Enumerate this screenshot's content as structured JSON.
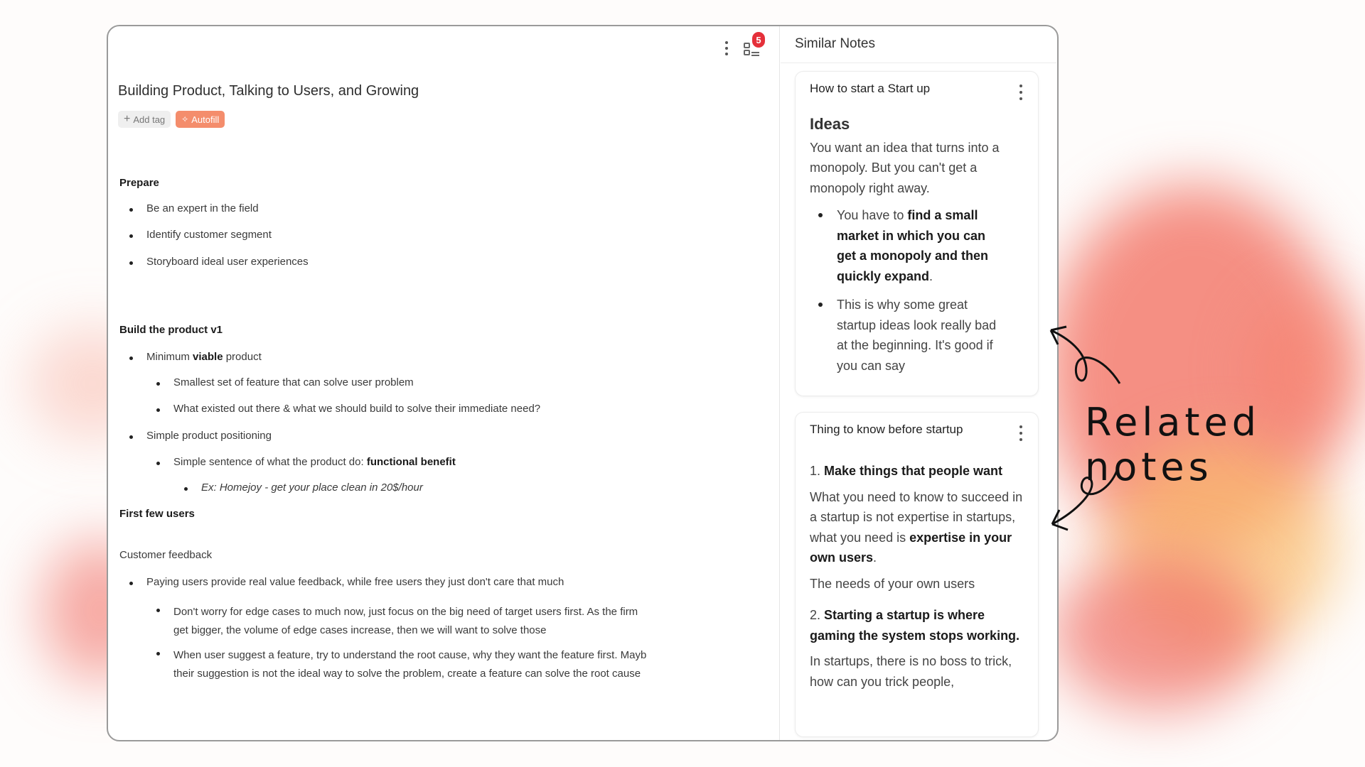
{
  "editor": {
    "toolbar": {
      "more_icon": "vertical-dots-icon",
      "list_icon": "checklist-icon",
      "badge_count": "5"
    },
    "title": "Building Product, Talking to Users, and Growing",
    "tags": {
      "add_tag": "Add tag",
      "autofill": "Autofill"
    },
    "sections": {
      "prepare": {
        "heading": "Prepare",
        "items": [
          "Be an expert in the field",
          "Identify customer segment",
          "Storyboard ideal user experiences"
        ]
      },
      "build": {
        "heading": "Build the product v1",
        "mvp_pre": "Minimum ",
        "mvp_bold": "viable",
        "mvp_post": " product",
        "mvp_sub": [
          "Smallest set of feature that can solve user problem",
          "What existed out there & what we should build to solve their immediate need?"
        ],
        "positioning": "Simple product positioning",
        "positioning_sub_pre": "Simple sentence of what the product do: ",
        "positioning_sub_bold": "functional benefit",
        "example": "Ex: Homejoy - get your place clean in 20$/hour"
      },
      "users": {
        "heading": "First few users",
        "subheading": "Customer feedback",
        "item": "Paying users provide real value feedback, while free users they just don't care that much",
        "sub1_line1": "Don't worry for edge cases to much now, just focus on the big need of target users first. As the firm",
        "sub1_line2": "get bigger, the volume of edge cases increase, then we will want to solve those",
        "sub2_line1": "When user suggest a feature, try to understand the root cause, why they want the feature first. Mayb",
        "sub2_line2": "their suggestion is not the ideal way to solve the problem, create a feature can solve the root cause"
      }
    }
  },
  "similar_notes": {
    "title": "Similar Notes",
    "cards": [
      {
        "title": "How to start a Start up",
        "heading": "Ideas",
        "para": "You want an idea that turns into a monopoly. But you can't get a monopoly right away.",
        "b1_pre": "You have to ",
        "b1_bold": "find a small market in which you can get a monopoly and then quickly expand",
        "b1_post": ".",
        "b2": "This is why some great startup ideas look really bad at the beginning. It's good if you can say"
      },
      {
        "title": "Thing to know before startup",
        "h1_num": "1. ",
        "h1": "Make things that people want",
        "p1_pre": "What you need to know to succeed in a startup is not expertise in startups, what you need is ",
        "p1_bold": "expertise in your own users",
        "p1_post": ".",
        "p2": "The needs of your own users",
        "h2_num": "2. ",
        "h2": "Starting a startup is where gaming the system stops working.",
        "p3": "In startups, there is no boss to trick, how can you trick people,"
      }
    ]
  },
  "annotation": {
    "label": "Related notes"
  },
  "colors": {
    "autofill": "#f48d6c",
    "badge": "#e5303a",
    "accent_blob": "#f26b5b"
  }
}
